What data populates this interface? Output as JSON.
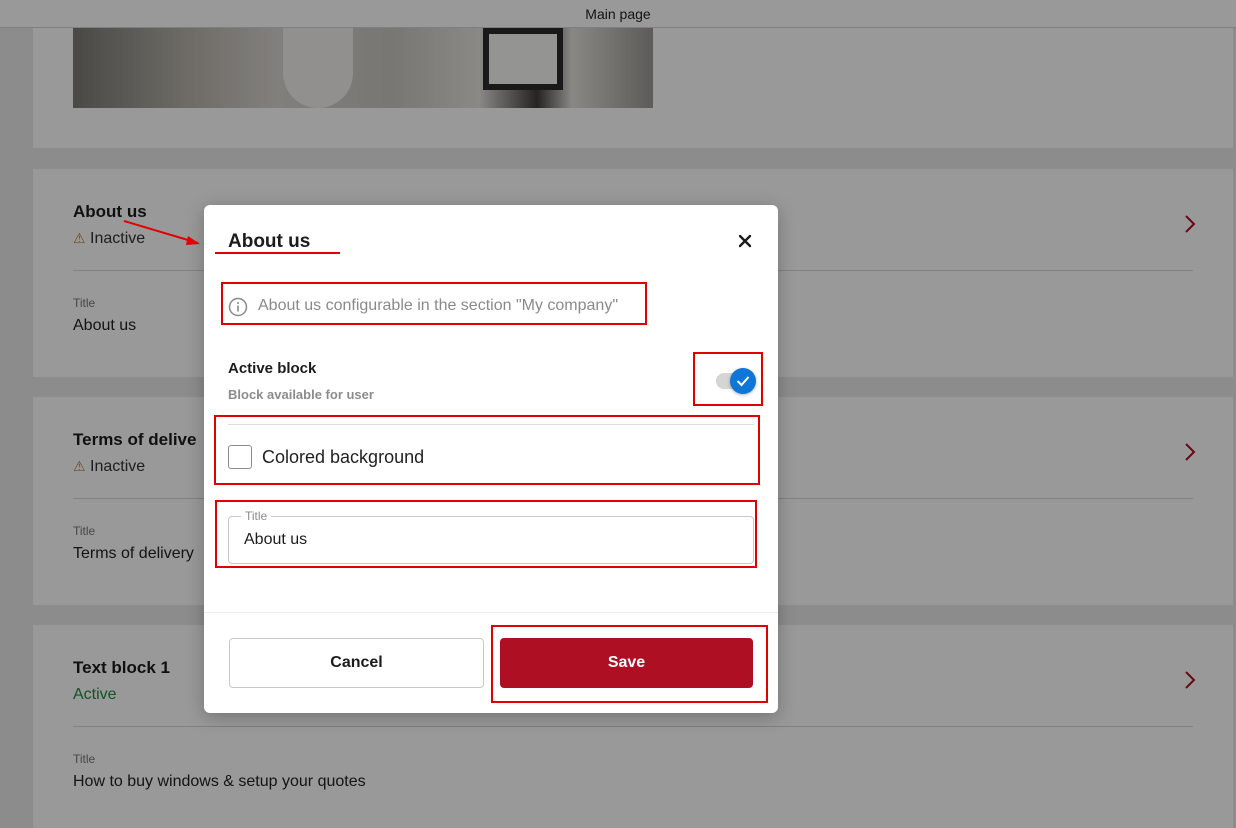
{
  "topbar": {
    "title": "Main page"
  },
  "blocks": [
    {
      "title": "About us",
      "status": "Inactive",
      "field_label": "Title",
      "field_value": "About us"
    },
    {
      "title": "Terms of delive",
      "status": "Inactive",
      "field_label": "Title",
      "field_value": "Terms of delivery"
    },
    {
      "title": "Text block 1",
      "status": "Active",
      "field_label": "Title",
      "field_value": "How to buy windows & setup your quotes"
    }
  ],
  "modal": {
    "title": "About us",
    "close_icon": "close-icon",
    "info_icon": "info-icon",
    "info_text": "About us configurable in the section \"My company\"",
    "active_block": {
      "label": "Active block",
      "sublabel": "Block available for user",
      "checked": true
    },
    "colored_background": {
      "label": "Colored background",
      "checked": false
    },
    "title_field": {
      "label": "Title",
      "value": "About us"
    },
    "cancel_label": "Cancel",
    "save_label": "Save"
  },
  "colors": {
    "accent": "#ae0f22",
    "toggle_on": "#0d76d6",
    "active_status": "#1e8a3a",
    "warning": "#c97a1a",
    "annotation": "#e00000"
  }
}
